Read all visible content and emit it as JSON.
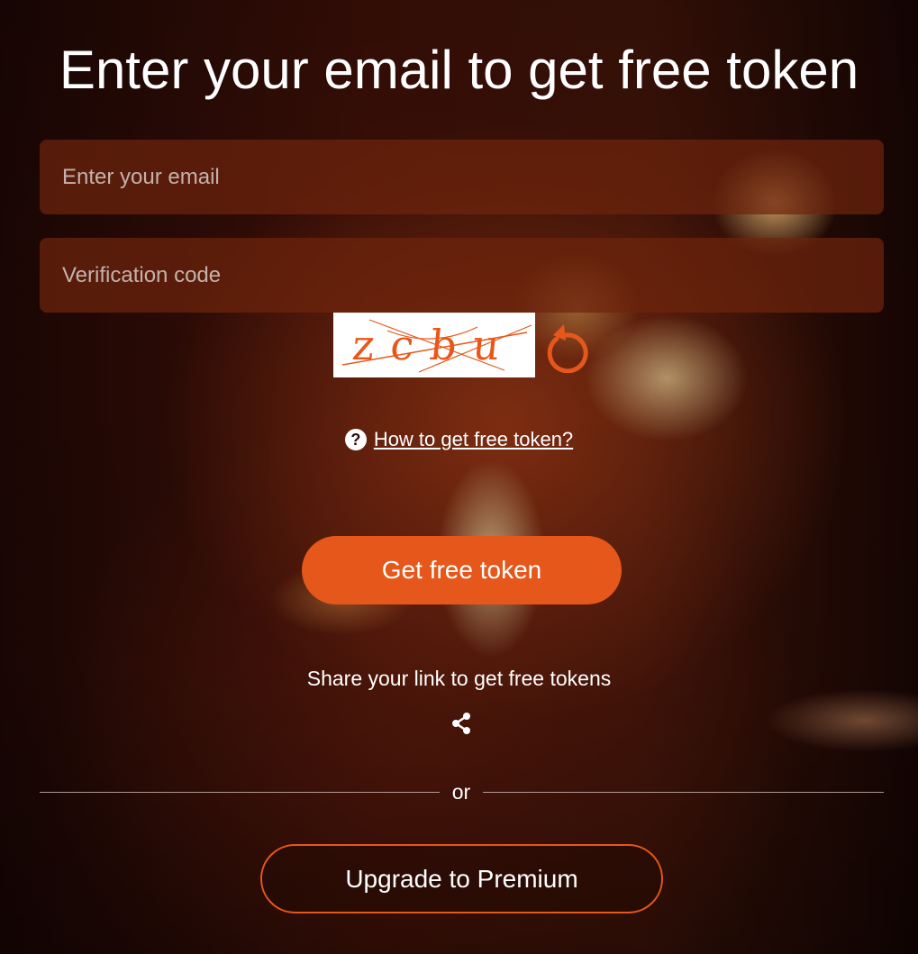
{
  "colors": {
    "accent": "#e5571a",
    "field_bg": "#6e240c",
    "text": "#ffffff"
  },
  "heading": {
    "title": "Enter your email to get free token"
  },
  "form": {
    "email_placeholder": "Enter your email",
    "code_placeholder": "Verification code",
    "captcha_text": "zcbu"
  },
  "help": {
    "icon": "question-circle-icon",
    "link_label": "How to get free token?"
  },
  "actions": {
    "get_token_label": "Get free token",
    "share_text": "Share your link to get free tokens",
    "share_icon": "share-icon",
    "or_label": "or",
    "premium_label": "Upgrade to Premium"
  },
  "icons": {
    "refresh": "refresh-icon"
  }
}
